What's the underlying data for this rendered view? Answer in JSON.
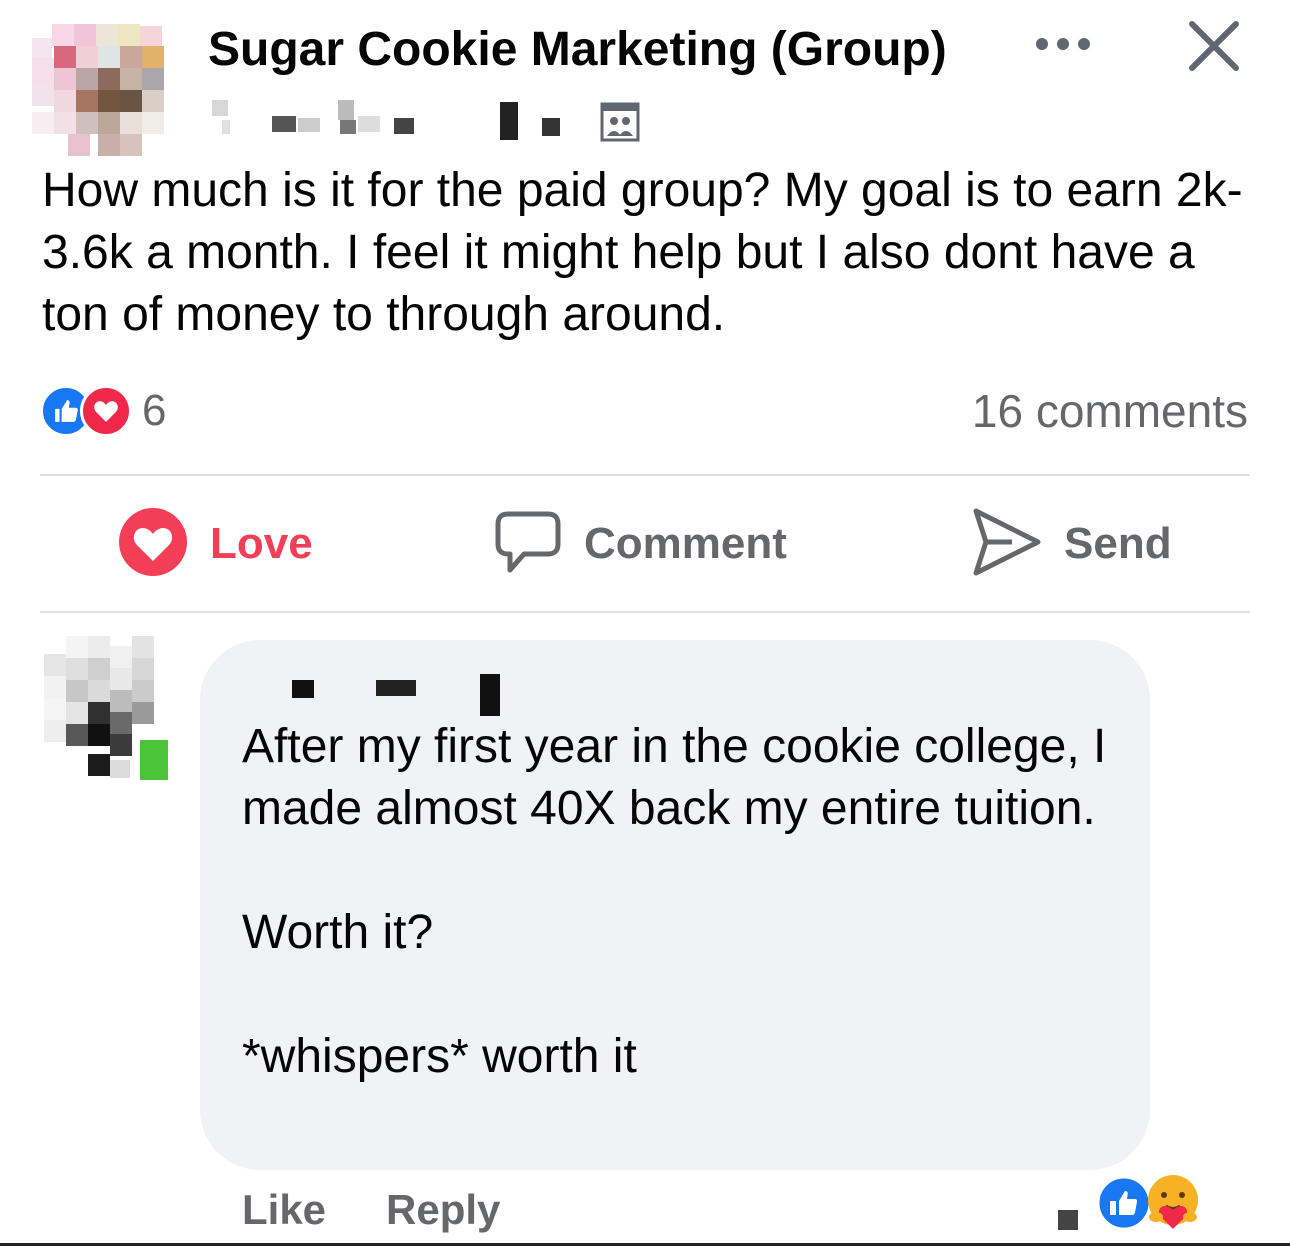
{
  "post": {
    "group_name": "Sugar Cookie Marketing (Group)",
    "text": "How much is it for the paid group? My goal is to earn 2k-3.6k a month. I feel it might help but I also dont have a ton of money to through around.",
    "reaction_count": "6",
    "reaction_types": [
      "like-icon",
      "love-icon"
    ],
    "comments_count": "16 comments"
  },
  "actions": {
    "love": "Love",
    "comment": "Comment",
    "send": "Send"
  },
  "comment": {
    "text": "After my first year in the cookie college, I made almost 40X  back my entire tuition.\n\nWorth it?\n\n*whispers* worth it",
    "like_label": "Like",
    "reply_label": "Reply",
    "reaction_types": [
      "like-icon",
      "care-icon"
    ]
  },
  "colors": {
    "love_red": "#f33e58",
    "like_blue": "#1877f2",
    "muted_gray": "#65676b",
    "bubble_bg": "#f0f2f5"
  }
}
